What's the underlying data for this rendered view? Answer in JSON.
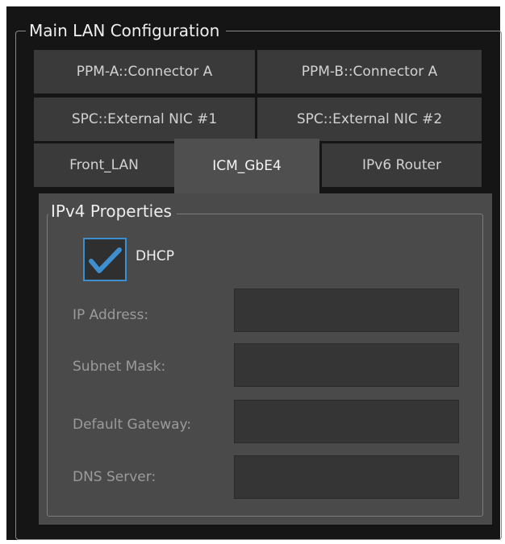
{
  "main_lan": {
    "title": "Main LAN Configuration",
    "tabs": [
      {
        "label": "PPM-A::Connector A",
        "active": false
      },
      {
        "label": "PPM-B::Connector A",
        "active": false
      },
      {
        "label": "SPC::External NIC #1",
        "active": false
      },
      {
        "label": "SPC::External NIC #2",
        "active": false
      },
      {
        "label": "Front_LAN",
        "active": false
      },
      {
        "label": "ICM_GbE4",
        "active": true
      },
      {
        "label": "IPv6 Router",
        "active": false
      }
    ]
  },
  "ipv4": {
    "title": "IPv4 Properties",
    "dhcp": {
      "label": "DHCP",
      "checked": true
    },
    "fields": [
      {
        "label": "IP Address:",
        "value": ""
      },
      {
        "label": "Subnet Mask:",
        "value": ""
      },
      {
        "label": "Default Gateway:",
        "value": ""
      },
      {
        "label": "DNS Server:",
        "value": ""
      }
    ]
  },
  "colors": {
    "panel_bg": "#151515",
    "tab_bg": "#3a3a3a",
    "tab_active_bg": "#4f4f4f",
    "accent_blue": "#3d8fd0"
  }
}
